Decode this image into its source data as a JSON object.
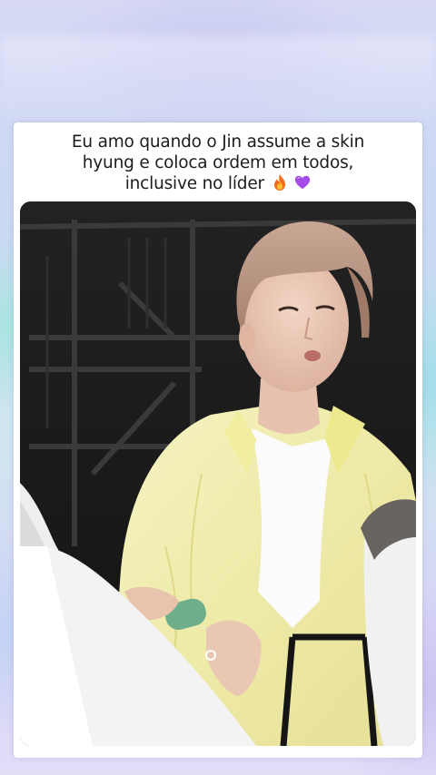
{
  "post": {
    "caption_line1": "Eu amo quando o Jin assume a skin",
    "caption_line2": "hyung e coloca ordem em todos,",
    "caption_line3": "inclusive no líder",
    "caption_emoji_1": "fire-emoji",
    "caption_emoji_2": "purple-heart-emoji"
  },
  "video": {
    "subject": "person-in-yellow-shirt-seated",
    "colors": {
      "background": "#1b1b1b",
      "shirt": "#f0eeb0",
      "hair": "#c3a08f",
      "pants": "#f2f2f2"
    }
  },
  "theme": {
    "card_background": "#ffffff",
    "text_color": "#1c1c1c"
  }
}
